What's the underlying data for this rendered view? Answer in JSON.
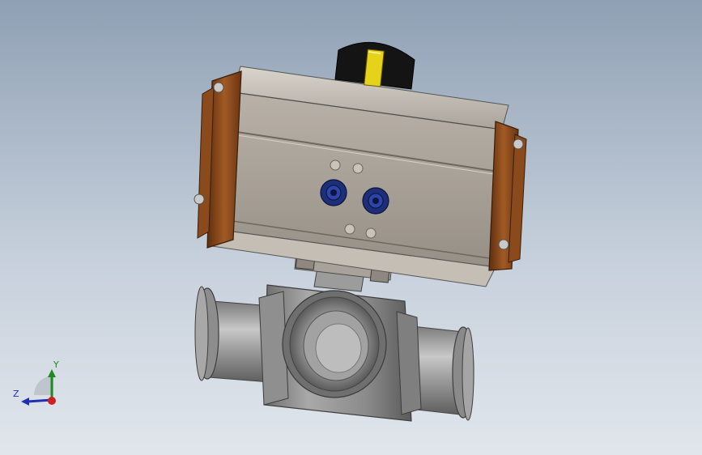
{
  "viewport": {
    "background_top": "#8fa0b4",
    "background_bottom": "#e1e6ec"
  },
  "triad": {
    "y_label": "Y",
    "z_label": "Z",
    "x_color": "#cc2020",
    "y_color": "#1f8a1f",
    "z_color": "#2030b0"
  },
  "model": {
    "actuator_body_color": "#b5aea4",
    "end_cap_color": "#8a4a1c",
    "indicator_color": "#e6d21a",
    "fitting_color": "#1e2f7a",
    "valve_body_color": "#9a9a9a"
  }
}
